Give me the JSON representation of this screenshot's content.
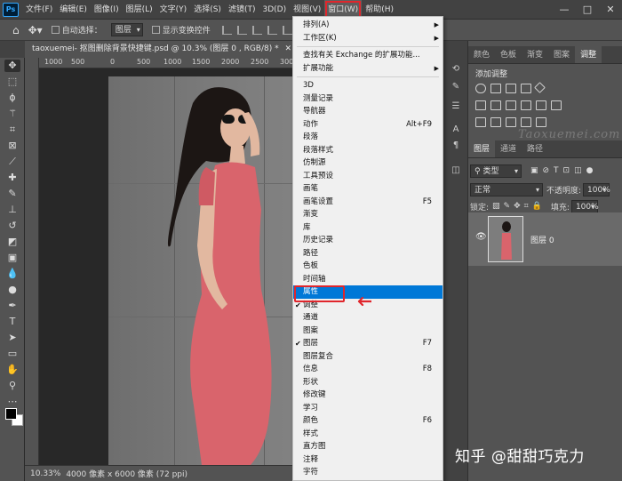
{
  "app": {
    "logo": "Ps"
  },
  "menubar": {
    "items": [
      "文件(F)",
      "编辑(E)",
      "图像(I)",
      "图层(L)",
      "文字(Y)",
      "选择(S)",
      "滤镜(T)",
      "3D(D)",
      "视图(V)",
      "窗口(W)",
      "帮助(H)"
    ],
    "active_index": 9,
    "active_outline_color": "#e0262c",
    "window_controls": [
      "—",
      "□",
      "✕"
    ]
  },
  "options_bar": {
    "auto_select_label": "自动选择：",
    "auto_select_value": "图层",
    "show_transform_label": "显示变换控件"
  },
  "document": {
    "tab_title": "taoxuemei- 抠图删除背景快捷键.psd @ 10.3% (图层 0 , RGB/8) *",
    "ruler_ticks": [
      "1000",
      "500",
      "0",
      "500",
      "1000",
      "1500",
      "2000",
      "2500",
      "3000",
      "3500",
      "4000",
      "4500",
      "5000",
      "5500"
    ]
  },
  "status_bar": {
    "zoom": "10.33%",
    "doc_size": "4000 像素 x 6000 像素 (72 ppi)"
  },
  "window_menu": {
    "highlight_color": "#0078d7",
    "items": [
      {
        "label": "排列(A)",
        "submenu": true
      },
      {
        "label": "工作区(K)",
        "submenu": true
      },
      {
        "sep": true
      },
      {
        "label": "查找有关 Exchange 的扩展功能..."
      },
      {
        "label": "扩展功能",
        "submenu": true
      },
      {
        "sep": true
      },
      {
        "label": "3D"
      },
      {
        "label": "测量记录"
      },
      {
        "label": "导航器"
      },
      {
        "label": "动作",
        "shortcut": "Alt+F9"
      },
      {
        "label": "段落"
      },
      {
        "label": "段落样式"
      },
      {
        "label": "仿制源"
      },
      {
        "label": "工具预设"
      },
      {
        "label": "画笔"
      },
      {
        "label": "画笔设置",
        "shortcut": "F5"
      },
      {
        "label": "渐变"
      },
      {
        "label": "库"
      },
      {
        "label": "历史记录"
      },
      {
        "label": "路径"
      },
      {
        "label": "色板"
      },
      {
        "label": "时间轴"
      },
      {
        "label": "属性",
        "highlighted": true
      },
      {
        "label": "调整",
        "checked": true
      },
      {
        "label": "通道"
      },
      {
        "label": "图案"
      },
      {
        "label": "图层",
        "checked": true,
        "shortcut": "F7"
      },
      {
        "label": "图层复合"
      },
      {
        "label": "信息",
        "shortcut": "F8"
      },
      {
        "label": "形状"
      },
      {
        "label": "修改键"
      },
      {
        "label": "学习"
      },
      {
        "label": "颜色",
        "shortcut": "F6"
      },
      {
        "label": "样式"
      },
      {
        "label": "直方图"
      },
      {
        "label": "注释"
      },
      {
        "label": "字符"
      }
    ]
  },
  "right_panel": {
    "top_tabs": [
      "颜色",
      "色板",
      "渐变",
      "图案",
      "调整"
    ],
    "top_active": 4,
    "adjust_title": "添加调整",
    "watermark": "Taoxuemei.com",
    "layer_tabs": [
      "图层",
      "通道",
      "路径"
    ],
    "layer_active": 0,
    "filter_label": "类型",
    "blend_mode": "正常",
    "opacity_label": "不透明度:",
    "opacity_value": "100%",
    "lock_label": "锁定:",
    "fill_label": "填充:",
    "fill_value": "100%",
    "layer_name": "图层 0"
  },
  "credit": "知乎 @甜甜巧克力"
}
